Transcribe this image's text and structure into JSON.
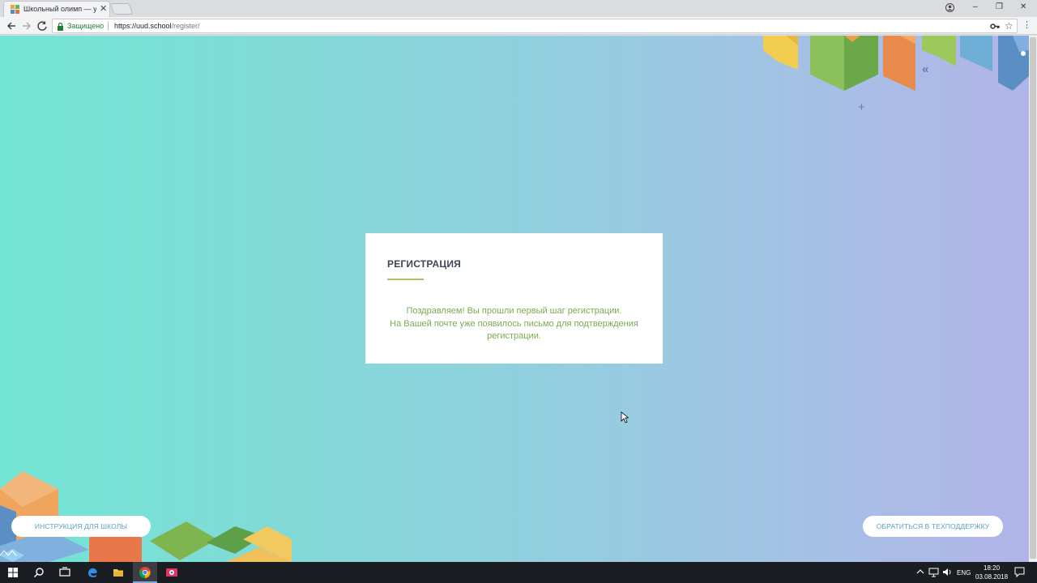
{
  "browser": {
    "tab_title": "Школьный олимп — уч",
    "tab_close": "✕",
    "secure_label": "Защищено",
    "url_host": "https://uud.school",
    "url_path": "/register/",
    "win_min": "–",
    "win_max": "❐",
    "win_close": "✕",
    "star": "☆",
    "menu": "⋮"
  },
  "page": {
    "chevrons": "«",
    "plus": "+",
    "card": {
      "title": "РЕГИСТРАЦИЯ",
      "message_lines": [
        "Поздравляем! Вы прошли первый шаг регистрации.",
        "На Вашей почте уже появилось письмо для подтверждения",
        "регистрации."
      ]
    },
    "instruction_button": "ИНСТРУКЦИЯ ДЛЯ ШКОЛЫ",
    "support_button": "ОБРАТИТЬСЯ В ТЕХПОДДЕРЖКУ"
  },
  "taskbar": {
    "lang": "ENG",
    "time": "18:20",
    "date": "03.08.2018"
  },
  "colors": {
    "accent_green": "#7aab4f",
    "button_text": "#5aa0c4",
    "title": "#3c4657"
  },
  "icons": [
    "windows-start-icon",
    "search-icon",
    "task-view-icon",
    "edge-icon",
    "file-explorer-icon",
    "chrome-icon",
    "app-icon",
    "chevron-up-icon",
    "network-icon",
    "volume-icon",
    "notification-icon"
  ]
}
